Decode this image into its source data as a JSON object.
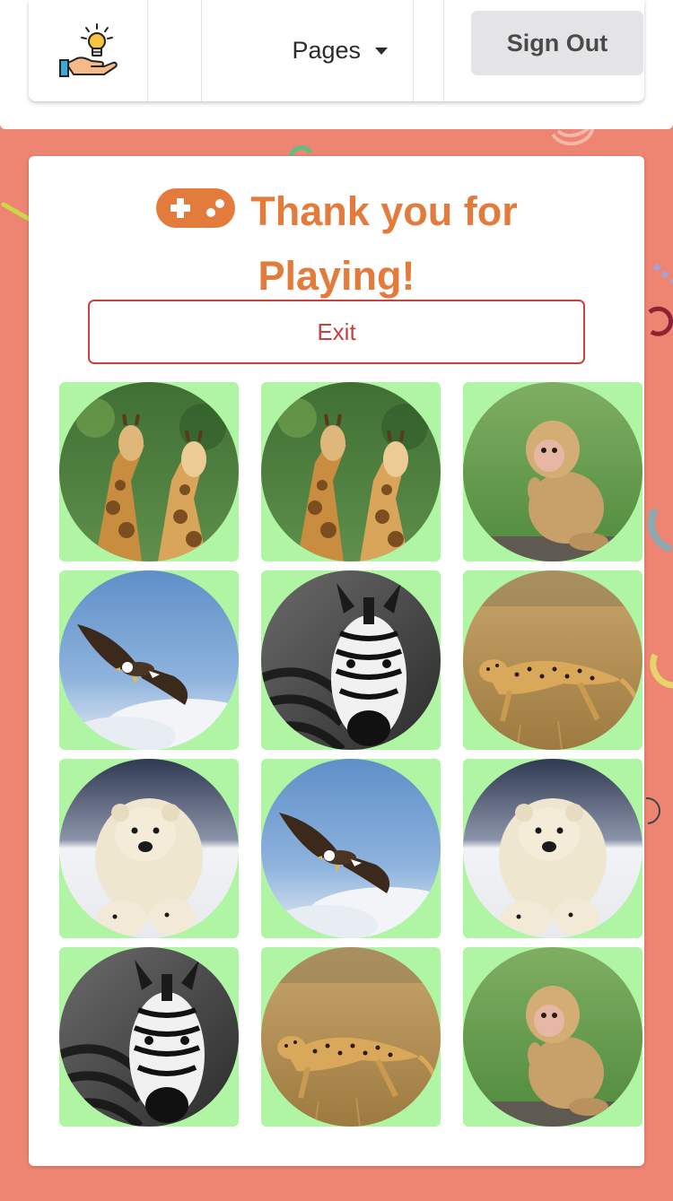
{
  "nav": {
    "logo_icon": "lightbulb-hand-icon",
    "pages_label": "Pages",
    "signout_label": "Sign Out"
  },
  "main": {
    "title_icon": "gamepad-icon",
    "title_line1": "Thank you for",
    "title_line2": "Playing!",
    "exit_label": "Exit"
  },
  "tiles": [
    {
      "animal": "giraffe"
    },
    {
      "animal": "giraffe"
    },
    {
      "animal": "monkey"
    },
    {
      "animal": "eagle"
    },
    {
      "animal": "zebra"
    },
    {
      "animal": "cheetah"
    },
    {
      "animal": "polar-bear"
    },
    {
      "animal": "eagle"
    },
    {
      "animal": "polar-bear"
    },
    {
      "animal": "zebra"
    },
    {
      "animal": "cheetah"
    },
    {
      "animal": "monkey"
    }
  ],
  "colors": {
    "background": "#ee8573",
    "title": "#e37b3c",
    "exit": "#c8413c",
    "tile": "#aff5a3"
  }
}
